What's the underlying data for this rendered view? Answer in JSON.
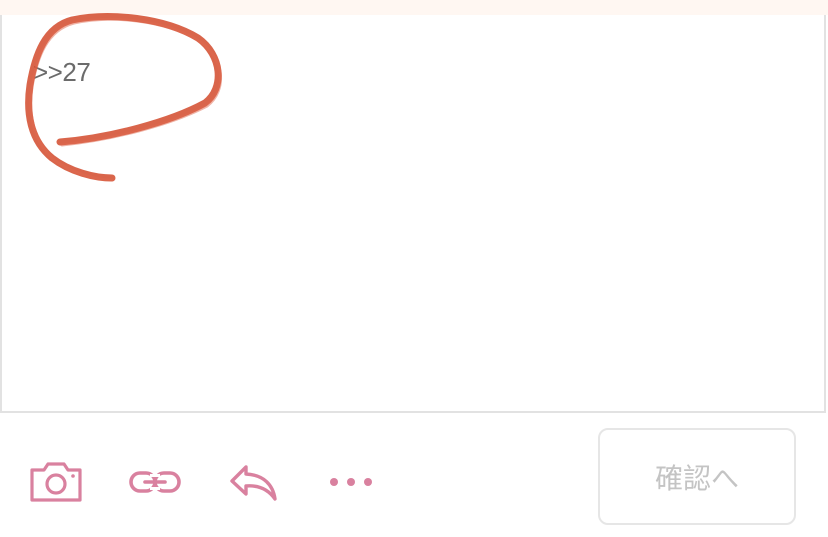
{
  "editor": {
    "text": ">>27"
  },
  "toolbar": {
    "icons": {
      "camera": "camera-icon",
      "link": "link-icon",
      "reply": "reply-icon",
      "more": "more-icon"
    },
    "confirm_label": "確認へ"
  },
  "colors": {
    "accent": "#d9819f",
    "scribble": "#d24a2c",
    "top_strip": "#fff7f2",
    "border": "#e2e2e2",
    "disabled_text": "#c4c4c4"
  }
}
